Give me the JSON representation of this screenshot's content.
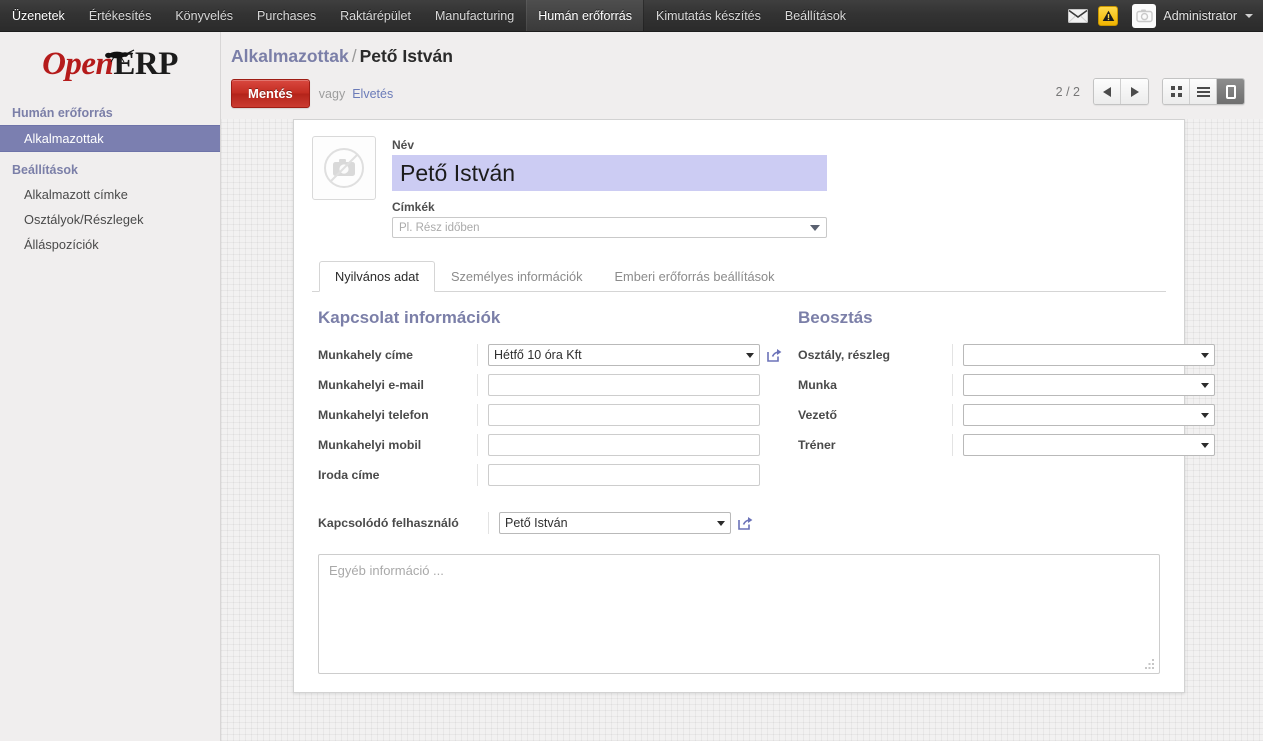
{
  "topbar": {
    "menu_items": [
      {
        "label": "Üzenetek",
        "active": false
      },
      {
        "label": "Értékesítés",
        "active": false
      },
      {
        "label": "Könyvelés",
        "active": false
      },
      {
        "label": "Purchases",
        "active": false
      },
      {
        "label": "Raktárépület",
        "active": false
      },
      {
        "label": "Manufacturing",
        "active": false
      },
      {
        "label": "Humán erőforrás",
        "active": true
      },
      {
        "label": "Kimutatás készítés",
        "active": false
      },
      {
        "label": "Beállítások",
        "active": false
      }
    ],
    "mail_icon": "envelope-icon",
    "warning_icon": "warning-triangle-icon",
    "avatar_icon": "camera-placeholder-icon",
    "user_name": "Administrator"
  },
  "sidebar": {
    "brand_open": "Open",
    "brand_erp": "ERP",
    "sections": [
      {
        "title": "Humán erőforrás",
        "items": [
          {
            "label": "Alkalmazottak",
            "active": true
          }
        ]
      },
      {
        "title": "Beállítások",
        "items": [
          {
            "label": "Alkalmazott címke",
            "active": false
          },
          {
            "label": "Osztályok/Részlegek",
            "active": false
          },
          {
            "label": "Álláspozíciók",
            "active": false
          }
        ]
      }
    ]
  },
  "breadcrumb": {
    "parent": "Alkalmazottak",
    "separator": "/",
    "current": "Pető István"
  },
  "toolbar": {
    "save_label": "Mentés",
    "or_label": "vagy",
    "discard_label": "Elvetés"
  },
  "pager": {
    "count": "2 / 2",
    "prev_icon": "arrow-left-icon",
    "next_icon": "arrow-right-icon",
    "views": [
      {
        "name": "kanban",
        "icon": "kanban-grid-icon",
        "active": false
      },
      {
        "name": "list",
        "icon": "list-lines-icon",
        "active": false
      },
      {
        "name": "form",
        "icon": "form-page-icon",
        "active": true
      }
    ]
  },
  "form": {
    "photo_icon": "no-camera-icon",
    "name_label": "Név",
    "name_value": "Pető István",
    "tags_label": "Címkék",
    "tags_placeholder": "Pl. Rész időben",
    "tabs": [
      {
        "label": "Nyilvános adat",
        "active": true
      },
      {
        "label": "Személyes információk",
        "active": false
      },
      {
        "label": "Emberi erőforrás beállítások",
        "active": false
      }
    ],
    "contact_group": {
      "title": "Kapcsolat információk",
      "fields": [
        {
          "label": "Munkahely címe",
          "type": "select",
          "value": "Hétfő 10 óra Kft",
          "has_external_link": true
        },
        {
          "label": "Munkahelyi e-mail",
          "type": "text",
          "value": "",
          "has_external_link": false
        },
        {
          "label": "Munkahelyi telefon",
          "type": "text",
          "value": "",
          "has_external_link": false
        },
        {
          "label": "Munkahelyi mobil",
          "type": "text",
          "value": "",
          "has_external_link": false
        },
        {
          "label": "Iroda címe",
          "type": "text",
          "value": "",
          "has_external_link": false
        }
      ]
    },
    "position_group": {
      "title": "Beosztás",
      "fields": [
        {
          "label": "Osztály, részleg",
          "type": "select",
          "value": ""
        },
        {
          "label": "Munka",
          "type": "select",
          "value": ""
        },
        {
          "label": "Vezető",
          "type": "select",
          "value": ""
        },
        {
          "label": "Tréner",
          "type": "select",
          "value": ""
        }
      ]
    },
    "linked_user": {
      "label": "Kapcsolódó felhasználó",
      "value": "Pető István",
      "external_link_icon": "open-record-icon"
    },
    "notes_placeholder": "Egyéb információ ...",
    "resize_icon": "resize-grip-icon"
  },
  "colors": {
    "accent_purple": "#7b7fa8",
    "sidebar_active": "#7b7fb0",
    "save_red": "#c32d22",
    "name_field_bg": "#ccccf3",
    "topbar_dark": "#333333",
    "warning_yellow": "#ffd94a"
  }
}
